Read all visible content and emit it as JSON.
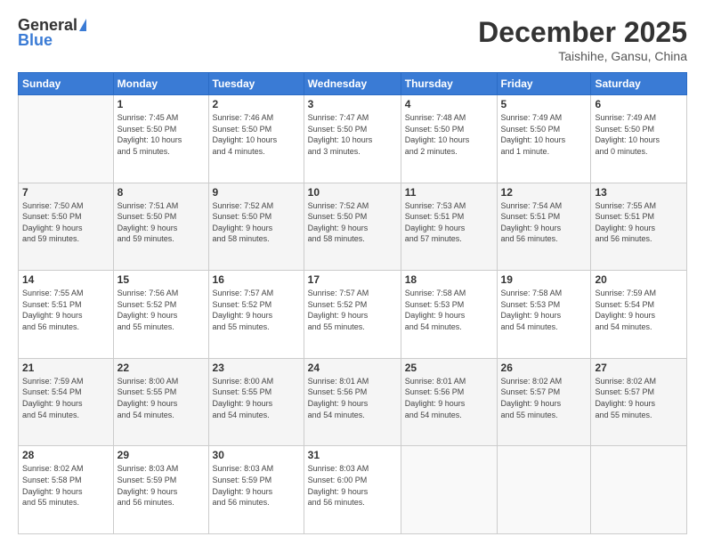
{
  "header": {
    "logo_general": "General",
    "logo_blue": "Blue",
    "month_title": "December 2025",
    "location": "Taishihe, Gansu, China"
  },
  "calendar": {
    "days_of_week": [
      "Sunday",
      "Monday",
      "Tuesday",
      "Wednesday",
      "Thursday",
      "Friday",
      "Saturday"
    ],
    "weeks": [
      [
        {
          "day": "",
          "info": ""
        },
        {
          "day": "1",
          "info": "Sunrise: 7:45 AM\nSunset: 5:50 PM\nDaylight: 10 hours\nand 5 minutes."
        },
        {
          "day": "2",
          "info": "Sunrise: 7:46 AM\nSunset: 5:50 PM\nDaylight: 10 hours\nand 4 minutes."
        },
        {
          "day": "3",
          "info": "Sunrise: 7:47 AM\nSunset: 5:50 PM\nDaylight: 10 hours\nand 3 minutes."
        },
        {
          "day": "4",
          "info": "Sunrise: 7:48 AM\nSunset: 5:50 PM\nDaylight: 10 hours\nand 2 minutes."
        },
        {
          "day": "5",
          "info": "Sunrise: 7:49 AM\nSunset: 5:50 PM\nDaylight: 10 hours\nand 1 minute."
        },
        {
          "day": "6",
          "info": "Sunrise: 7:49 AM\nSunset: 5:50 PM\nDaylight: 10 hours\nand 0 minutes."
        }
      ],
      [
        {
          "day": "7",
          "info": "Sunrise: 7:50 AM\nSunset: 5:50 PM\nDaylight: 9 hours\nand 59 minutes."
        },
        {
          "day": "8",
          "info": "Sunrise: 7:51 AM\nSunset: 5:50 PM\nDaylight: 9 hours\nand 59 minutes."
        },
        {
          "day": "9",
          "info": "Sunrise: 7:52 AM\nSunset: 5:50 PM\nDaylight: 9 hours\nand 58 minutes."
        },
        {
          "day": "10",
          "info": "Sunrise: 7:52 AM\nSunset: 5:50 PM\nDaylight: 9 hours\nand 58 minutes."
        },
        {
          "day": "11",
          "info": "Sunrise: 7:53 AM\nSunset: 5:51 PM\nDaylight: 9 hours\nand 57 minutes."
        },
        {
          "day": "12",
          "info": "Sunrise: 7:54 AM\nSunset: 5:51 PM\nDaylight: 9 hours\nand 56 minutes."
        },
        {
          "day": "13",
          "info": "Sunrise: 7:55 AM\nSunset: 5:51 PM\nDaylight: 9 hours\nand 56 minutes."
        }
      ],
      [
        {
          "day": "14",
          "info": "Sunrise: 7:55 AM\nSunset: 5:51 PM\nDaylight: 9 hours\nand 56 minutes."
        },
        {
          "day": "15",
          "info": "Sunrise: 7:56 AM\nSunset: 5:52 PM\nDaylight: 9 hours\nand 55 minutes."
        },
        {
          "day": "16",
          "info": "Sunrise: 7:57 AM\nSunset: 5:52 PM\nDaylight: 9 hours\nand 55 minutes."
        },
        {
          "day": "17",
          "info": "Sunrise: 7:57 AM\nSunset: 5:52 PM\nDaylight: 9 hours\nand 55 minutes."
        },
        {
          "day": "18",
          "info": "Sunrise: 7:58 AM\nSunset: 5:53 PM\nDaylight: 9 hours\nand 54 minutes."
        },
        {
          "day": "19",
          "info": "Sunrise: 7:58 AM\nSunset: 5:53 PM\nDaylight: 9 hours\nand 54 minutes."
        },
        {
          "day": "20",
          "info": "Sunrise: 7:59 AM\nSunset: 5:54 PM\nDaylight: 9 hours\nand 54 minutes."
        }
      ],
      [
        {
          "day": "21",
          "info": "Sunrise: 7:59 AM\nSunset: 5:54 PM\nDaylight: 9 hours\nand 54 minutes."
        },
        {
          "day": "22",
          "info": "Sunrise: 8:00 AM\nSunset: 5:55 PM\nDaylight: 9 hours\nand 54 minutes."
        },
        {
          "day": "23",
          "info": "Sunrise: 8:00 AM\nSunset: 5:55 PM\nDaylight: 9 hours\nand 54 minutes."
        },
        {
          "day": "24",
          "info": "Sunrise: 8:01 AM\nSunset: 5:56 PM\nDaylight: 9 hours\nand 54 minutes."
        },
        {
          "day": "25",
          "info": "Sunrise: 8:01 AM\nSunset: 5:56 PM\nDaylight: 9 hours\nand 54 minutes."
        },
        {
          "day": "26",
          "info": "Sunrise: 8:02 AM\nSunset: 5:57 PM\nDaylight: 9 hours\nand 55 minutes."
        },
        {
          "day": "27",
          "info": "Sunrise: 8:02 AM\nSunset: 5:57 PM\nDaylight: 9 hours\nand 55 minutes."
        }
      ],
      [
        {
          "day": "28",
          "info": "Sunrise: 8:02 AM\nSunset: 5:58 PM\nDaylight: 9 hours\nand 55 minutes."
        },
        {
          "day": "29",
          "info": "Sunrise: 8:03 AM\nSunset: 5:59 PM\nDaylight: 9 hours\nand 56 minutes."
        },
        {
          "day": "30",
          "info": "Sunrise: 8:03 AM\nSunset: 5:59 PM\nDaylight: 9 hours\nand 56 minutes."
        },
        {
          "day": "31",
          "info": "Sunrise: 8:03 AM\nSunset: 6:00 PM\nDaylight: 9 hours\nand 56 minutes."
        },
        {
          "day": "",
          "info": ""
        },
        {
          "day": "",
          "info": ""
        },
        {
          "day": "",
          "info": ""
        }
      ]
    ]
  }
}
